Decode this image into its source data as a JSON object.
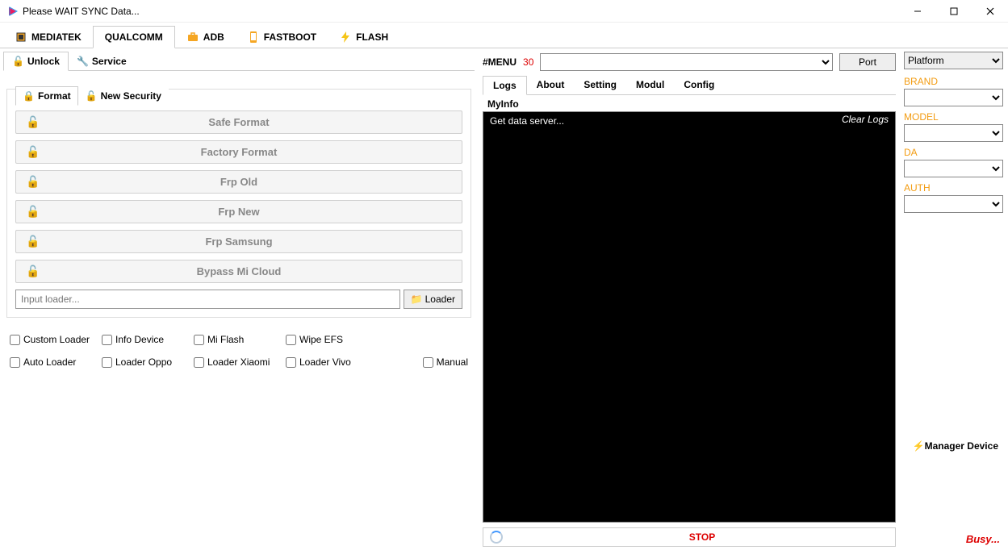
{
  "title": "Please WAIT SYNC Data...",
  "device_tabs": [
    "MEDIATEK",
    "QUALCOMM",
    "ADB",
    "FASTBOOT",
    "FLASH"
  ],
  "device_tabs_active": 1,
  "left_tabs": [
    "Unlock",
    "Service"
  ],
  "left_tabs_active": 0,
  "format_tabs": [
    "Format",
    "New Security"
  ],
  "format_tabs_active": 0,
  "actions": [
    "Safe Format",
    "Factory Format",
    "Frp Old",
    "Frp New",
    "Frp Samsung",
    "Bypass Mi Cloud"
  ],
  "loader_placeholder": "Input loader...",
  "loader_button": "Loader",
  "checks_row1": [
    "Custom Loader",
    "Info Device",
    "Mi Flash",
    "Wipe EFS"
  ],
  "checks_row2": [
    "Auto Loader",
    "Loader Oppo",
    "Loader Xiaomi",
    "Loader Vivo"
  ],
  "manual_check": "Manual",
  "menu_label": "#MENU",
  "menu_count": "30",
  "port_button": "Port",
  "log_tabs": [
    "Logs",
    "About",
    "Setting",
    "Modul",
    "Config"
  ],
  "log_tabs_active": 0,
  "myinfo_label": "MyInfo",
  "log_line": "Get data server...",
  "clear_logs": "Clear Logs",
  "stop_label": "STOP",
  "right_top_select": "Platform",
  "right_labels": {
    "brand": "BRAND",
    "model": "MODEL",
    "da": "DA",
    "auth": "AUTH"
  },
  "manager_label": "Manager Device",
  "busy_label": "Busy..."
}
